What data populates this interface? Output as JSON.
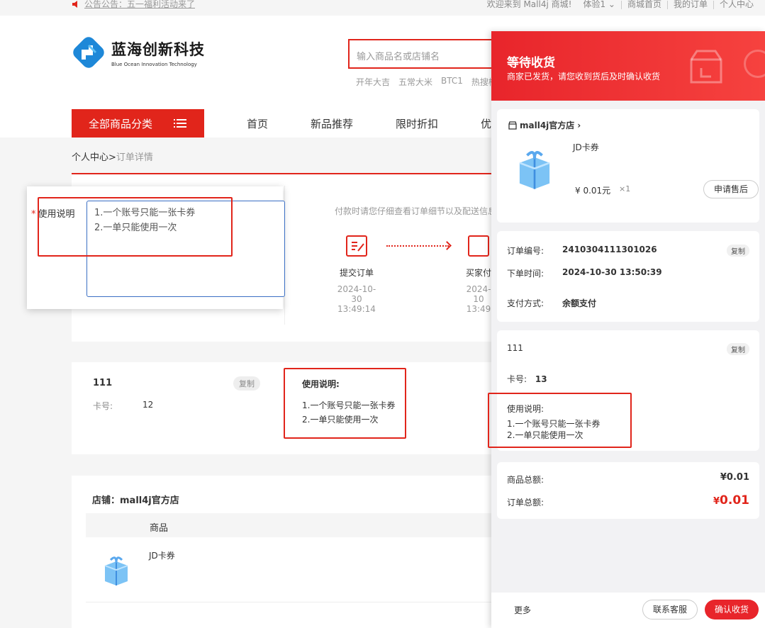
{
  "topbar": {
    "notice": "公告公告：五一福利活动来了",
    "welcome": "欢迎来到 Mall4j 商城!",
    "user": "体验1",
    "links": [
      "商城首页",
      "我的订单",
      "个人中心"
    ]
  },
  "logo": {
    "title": "蓝海创新科技",
    "subtitle": "Blue Ocean Innovation Technology"
  },
  "search": {
    "placeholder": "输入商品名或店铺名"
  },
  "hotwords": [
    "开年大吉",
    "五常大米",
    "BTC1",
    "热搜榜"
  ],
  "nav": {
    "category": "全部商品分类",
    "items": [
      "首页",
      "新品推荐",
      "限时折扣",
      "优"
    ]
  },
  "breadcrumb": {
    "home": "个人中心",
    "sep": ">",
    "current": "订单详情"
  },
  "popup": {
    "label": "使用说明",
    "value": "1.一个账号只能一张卡券\n2.一单只能使用一次"
  },
  "progress": {
    "tip": "付款时请您仔细查看订单细节以及配送信息",
    "steps": [
      {
        "name": "提交订单",
        "date": "2024-10-30",
        "time": "13:49:14"
      },
      {
        "name": "买家付",
        "date": "2024-10",
        "time": "13:49"
      }
    ]
  },
  "card_info": {
    "name": "111",
    "copy": "复制",
    "card_no_label": "卡号:",
    "card_no": "12",
    "usage_title": "使用说明:",
    "usage_lines": [
      "1.一个账号只能一张卡券",
      "2.一单只能使用一次"
    ]
  },
  "shop": {
    "label": "店铺：mall4j官方店",
    "col_product": "商品",
    "product_name": "JD卡券"
  },
  "drawer": {
    "status": "等待收货",
    "status_desc": "商家已发货，请您收到货后及时确认收货",
    "shop_name": "mall4j官方店",
    "product": {
      "name": "JD卡券",
      "price": "¥ 0.01元",
      "qty": "×1",
      "after_sale": "申请售后"
    },
    "order": {
      "no_label": "订单编号:",
      "no": "2410304111301026",
      "copy": "复制",
      "time_label": "下单时间:",
      "time": "2024-10-30 13:50:39",
      "pay_label": "支付方式:",
      "pay": "余额支付"
    },
    "card": {
      "name": "111",
      "copy": "复制",
      "card_no_label": "卡号:",
      "card_no": "13",
      "usage_title": "使用说明:",
      "usage_lines": [
        "1.一个账号只能一张卡券",
        "2.一单只能使用一次"
      ]
    },
    "totals": {
      "goods_label": "商品总额:",
      "goods": "¥0.01",
      "order_label": "订单总额:",
      "order_currency": "¥",
      "order": "0.01"
    },
    "footer": {
      "more": "更多",
      "contact": "联系客服",
      "confirm": "确认收货"
    }
  },
  "colors": {
    "brand_red": "#e1251b",
    "focus_blue": "#3b6fc4"
  }
}
